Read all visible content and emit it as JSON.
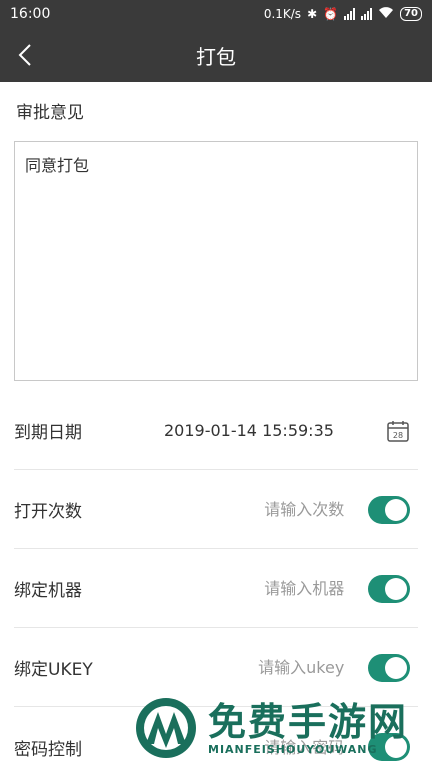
{
  "status_bar": {
    "time": "16:00",
    "net_speed": "0.1K/s",
    "battery": "70"
  },
  "header": {
    "title": "打包"
  },
  "approval": {
    "label": "审批意见",
    "comment": "同意打包"
  },
  "rows": {
    "expiry": {
      "label": "到期日期",
      "value": "2019-01-14 15:59:35",
      "calendar_day": "28"
    },
    "open_count": {
      "label": "打开次数",
      "placeholder": "请输入次数",
      "enabled": true
    },
    "bind_machine": {
      "label": "绑定机器",
      "placeholder": "请输入机器",
      "enabled": true
    },
    "bind_ukey": {
      "label": "绑定UKEY",
      "placeholder": "请输入ukey",
      "enabled": true
    },
    "password": {
      "label": "密码控制",
      "placeholder": "请输入密码",
      "enabled": true
    }
  },
  "watermark": {
    "name": "免费手游网",
    "domain": "MIANFEISHOUYOUWANG"
  },
  "colors": {
    "bar": "#3a3a3a",
    "toggle_on": "#1e8f76",
    "watermark": "#1a6f5c"
  }
}
